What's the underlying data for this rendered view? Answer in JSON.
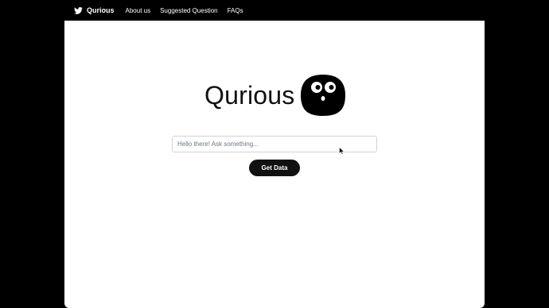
{
  "nav": {
    "brand": "Qurious",
    "brand_icon": "twitter-bird-icon",
    "links": [
      "About us",
      "Suggested Question",
      "FAQs"
    ]
  },
  "main": {
    "logo_text": "Qurious",
    "mascot_icon": "surprised-face-mascot-icon",
    "search_placeholder": "Hello there! Ask something...",
    "search_value": "",
    "button_label": "Get Data"
  },
  "colors": {
    "background": "#000000",
    "surface": "#ffffff",
    "button": "#111111",
    "input_border": "#cfd4d9"
  }
}
